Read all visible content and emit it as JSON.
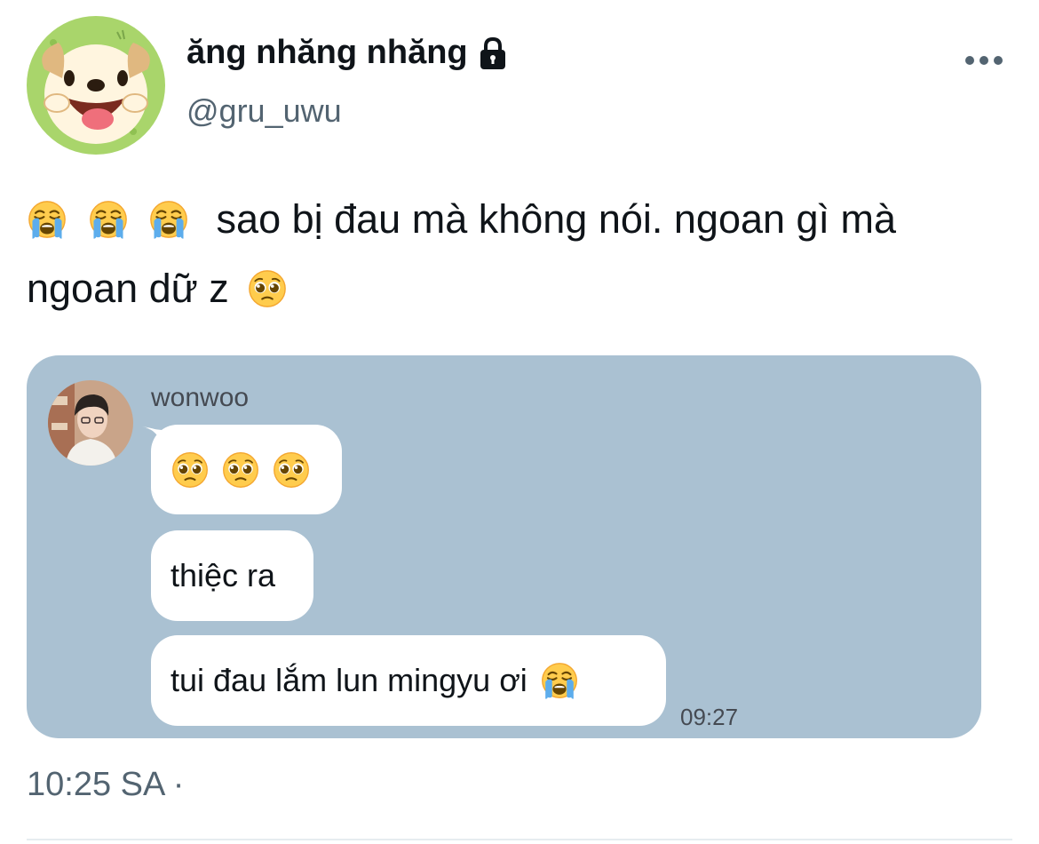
{
  "author": {
    "display_name": "ăng nhăng nhăng",
    "handle": "@gru_uwu"
  },
  "tweet": {
    "text_line_part1": "sao bị đau mà không nói.  ngoan gì mà ngoan dữ z",
    "timestamp": "10:25 SA ·"
  },
  "chat": {
    "sender": "wonwoo",
    "messages": [
      {
        "text": ""
      },
      {
        "text": "thiệc ra"
      },
      {
        "text": "tui đau lắm lun mingyu ơi"
      }
    ],
    "time": "09:27"
  },
  "icons": {
    "avatar": "dog-avatar-icon",
    "lock": "lock-icon",
    "more": "more-dots-icon",
    "crying_emoji": "loudly-crying-face-icon",
    "pleading_emoji": "pleading-face-icon"
  },
  "colors": {
    "text": "#0f1419",
    "secondary": "#536471",
    "chat_background": "#aac1d2",
    "bubble": "#ffffff"
  }
}
